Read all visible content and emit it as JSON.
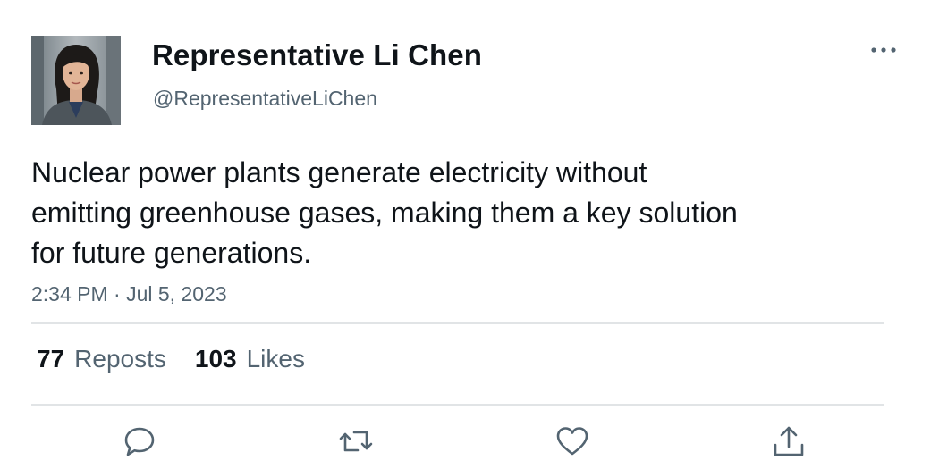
{
  "author": {
    "display_name": "Representative Li Chen",
    "handle": "@RepresentativeLiChen"
  },
  "tweet": {
    "text": "Nuclear power plants generate electricity without\nemitting greenhouse gases, making them a key solution\nfor future generations.",
    "timestamp": "2:34 PM · Jul 5, 2023"
  },
  "stats": {
    "reposts_count": "77",
    "reposts_label": "Reposts",
    "likes_count": "103",
    "likes_label": "Likes"
  },
  "icons": {
    "more": "more-horizontal-icon",
    "reply": "reply-bubble-icon",
    "repost": "repost-arrows-icon",
    "like": "heart-icon",
    "share": "share-upload-icon"
  },
  "colors": {
    "text_primary": "#0f1419",
    "text_secondary": "#536471",
    "divider": "#e1e4e6"
  }
}
